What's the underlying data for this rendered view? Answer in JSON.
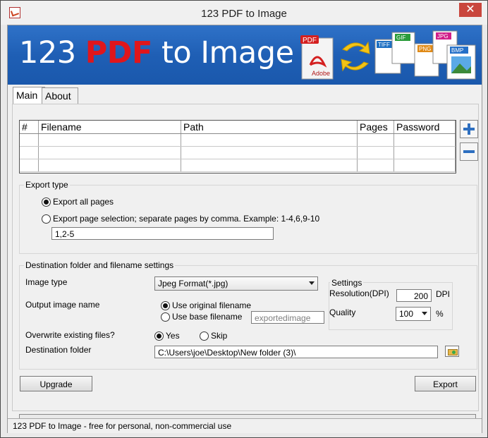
{
  "window": {
    "title": "123 PDF to Image",
    "close_symbol": "✕"
  },
  "banner": {
    "part1": "123 ",
    "part2": "PDF",
    "part3": " to Image",
    "art_labels": {
      "pdf": "PDF",
      "adobe": "Adobe",
      "tiff": "TIFF",
      "gif": "GIF",
      "png": "PNG",
      "jpg": "JPG",
      "bmp": "BMP"
    }
  },
  "tabs": [
    {
      "label": "Main"
    },
    {
      "label": "About"
    }
  ],
  "file_table": {
    "columns": [
      "#",
      "Filename",
      "Path",
      "Pages",
      "Password"
    ],
    "rows": []
  },
  "export_type": {
    "legend": "Export type",
    "option_all": "Export all pages",
    "option_selection": "Export page selection; separate pages by comma. Example: 1-4,6,9-10",
    "selection_value": "1,2-5",
    "selected": "all"
  },
  "destination": {
    "legend": "Destination folder and filename settings",
    "image_type_label": "Image type",
    "image_type_value": "Jpeg Format(*.jpg)",
    "output_name_label": "Output image name",
    "use_original": "Use original filename",
    "use_base": "Use base filename",
    "base_placeholder": "exportedimage",
    "output_selected": "original",
    "overwrite_label": "Overwrite existing files?",
    "overwrite_yes": "Yes",
    "overwrite_skip": "Skip",
    "overwrite_selected": "yes",
    "folder_label": "Destination folder",
    "folder_value": "C:\\Users\\joe\\Desktop\\New folder (3)\\"
  },
  "settings": {
    "legend": "Settings",
    "resolution_label": "Resolution(DPI)",
    "resolution_value": "200",
    "resolution_unit": "DPI",
    "quality_label": "Quality",
    "quality_value": "100",
    "quality_unit": "%"
  },
  "buttons": {
    "upgrade": "Upgrade",
    "export": "Export"
  },
  "status": {
    "text": "123 PDF to Image - free for personal, non-commercial use"
  },
  "progress": {
    "fraction": 0
  }
}
